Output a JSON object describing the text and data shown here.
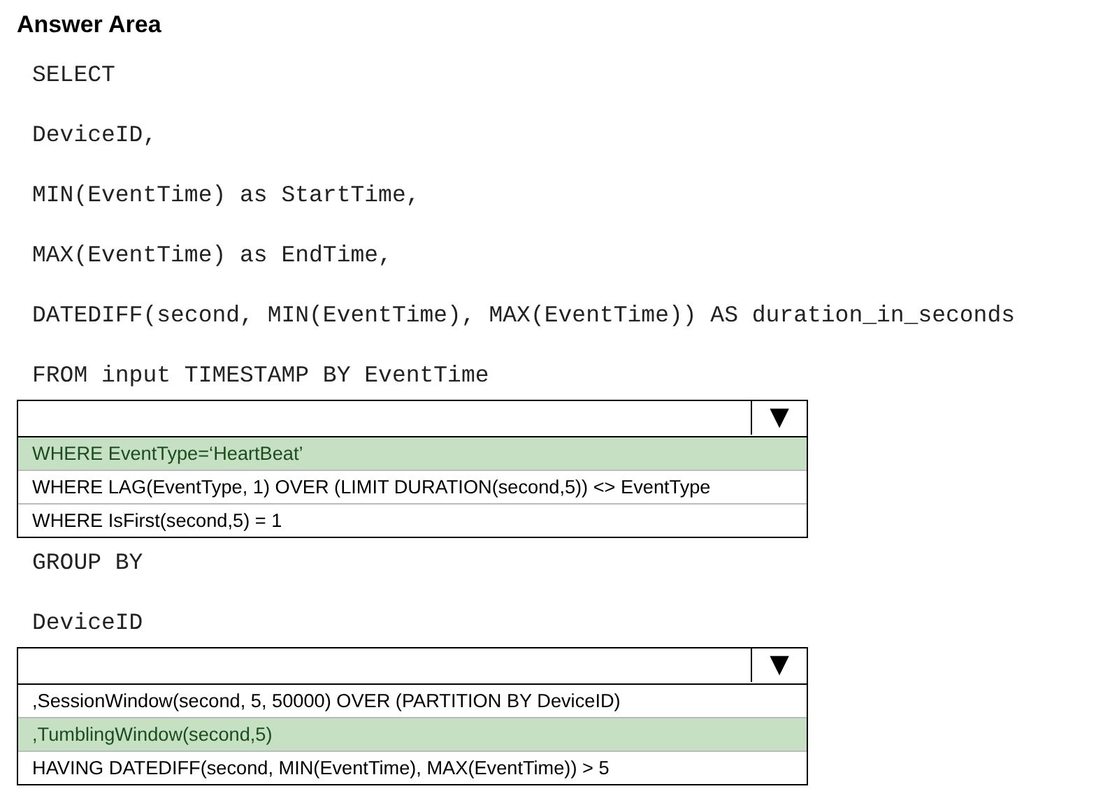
{
  "title": "Answer Area",
  "items": [
    {
      "kind": "code",
      "text": "SELECT"
    },
    {
      "kind": "code",
      "text": "DeviceID,"
    },
    {
      "kind": "code",
      "text": "MIN(EventTime) as StartTime,"
    },
    {
      "kind": "code",
      "text": "MAX(EventTime) as EndTime,"
    },
    {
      "kind": "code",
      "text": "DATEDIFF(second, MIN(EventTime), MAX(EventTime)) AS duration_in_seconds"
    },
    {
      "kind": "code",
      "text": "FROM input TIMESTAMP BY EventTime"
    },
    {
      "kind": "dropdown",
      "arrow": "▼",
      "options": [
        {
          "label": "WHERE EventType=‘HeartBeat’",
          "selected": true
        },
        {
          "label": "WHERE LAG(EventType, 1) OVER (LIMIT DURATION(second,5)) <> EventType",
          "selected": false
        },
        {
          "label": "WHERE IsFirst(second,5) = 1",
          "selected": false
        }
      ]
    },
    {
      "kind": "code",
      "text": "GROUP BY"
    },
    {
      "kind": "code",
      "text": "DeviceID"
    },
    {
      "kind": "dropdown",
      "arrow": "▼",
      "options": [
        {
          "label": ",SessionWindow(second, 5, 50000) OVER (PARTITION BY DeviceID)",
          "selected": false
        },
        {
          "label": ",TumblingWindow(second,5)",
          "selected": true
        },
        {
          "label": "HAVING DATEDIFF(second, MIN(EventTime), MAX(EventTime)) > 5",
          "selected": false
        }
      ]
    }
  ]
}
